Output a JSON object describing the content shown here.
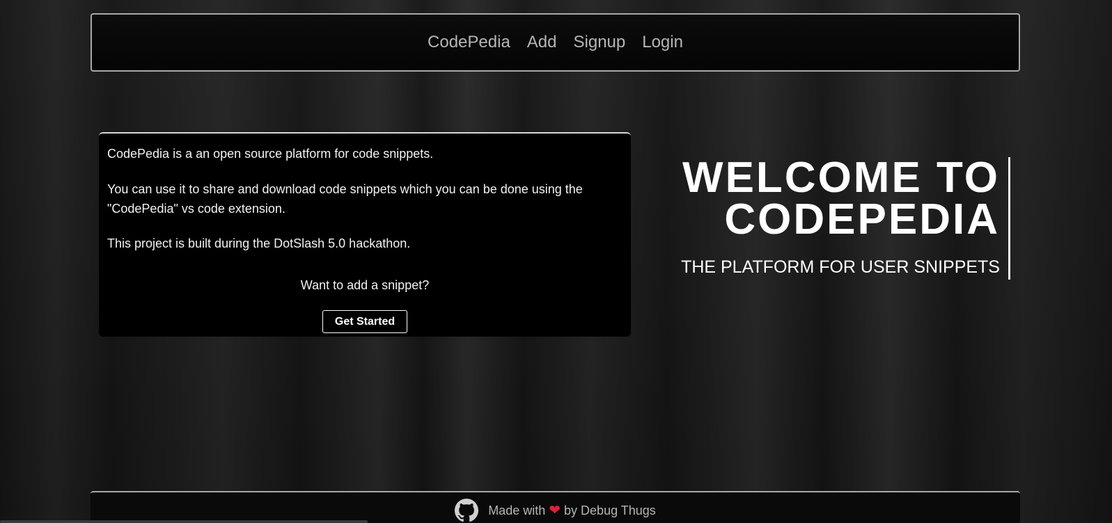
{
  "nav": {
    "links": [
      "CodePedia",
      "Add",
      "Signup",
      "Login"
    ]
  },
  "info": {
    "paragraph1": "CodePedia is a an open source platform for code snippets.",
    "paragraph2": "You can use it to share and download code snippets which you can be done using the \"CodePedia\" vs code extension.",
    "paragraph3": "This project is built during the DotSlash 5.0 hackathon.",
    "cta_text": "Want to add a snippet?",
    "cta_button": "Get Started"
  },
  "hero": {
    "title_line1": "WELCOME TO",
    "title_line2": "CODEPEDIA",
    "subtitle": "THE PLATFORM FOR USER SNIPPETS"
  },
  "footer": {
    "made_with": "Made with",
    "heart": "❤",
    "by": "by Debug Thugs",
    "icon": "github-icon"
  },
  "colors": {
    "background": "#161616",
    "panel": "#000000",
    "nav_text": "#b5b5b5",
    "border": "#a9a9a9",
    "heart": "#e0203c"
  }
}
